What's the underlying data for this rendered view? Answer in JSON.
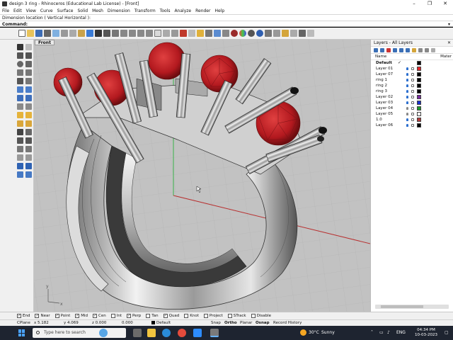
{
  "window": {
    "title": "design 3 ring - Rhinoceros (Educational Lab License) - [Front]",
    "minimize": "–",
    "maximize": "❐",
    "close": "✕"
  },
  "menu": [
    "File",
    "Edit",
    "View",
    "Curve",
    "Surface",
    "Solid",
    "Mesh",
    "Dimension",
    "Transform",
    "Tools",
    "Analyze",
    "Render",
    "Help"
  ],
  "command": {
    "history": "Dimension location ( Vertical  Horizontal ):",
    "label": "Command:",
    "value": ""
  },
  "viewport": {
    "name": "Front",
    "axis_y": "y",
    "axis_x": "x"
  },
  "layers_panel": {
    "title": "Layers - All Layers",
    "close": "✕",
    "col_name": "Name",
    "col_material": "Mater",
    "layers": [
      {
        "name": "Default",
        "current": true,
        "color": "#000000",
        "on": true
      },
      {
        "name": "Layer 01",
        "current": false,
        "color": "#e8262a",
        "on": true
      },
      {
        "name": "Layer 07",
        "current": false,
        "color": "#000000",
        "on": true
      },
      {
        "name": "ring 1",
        "current": false,
        "color": "#000000",
        "on": true
      },
      {
        "name": "ring 2",
        "current": false,
        "color": "#000000",
        "on": true
      },
      {
        "name": "ring 3",
        "current": false,
        "color": "#000000",
        "on": true
      },
      {
        "name": "Layer 02",
        "current": false,
        "color": "#7a2b9e",
        "on": true
      },
      {
        "name": "Layer 03",
        "current": false,
        "color": "#1a2fd0",
        "on": true
      },
      {
        "name": "Layer 04",
        "current": false,
        "color": "#1e9a2a",
        "on": false
      },
      {
        "name": "Layer 05",
        "current": false,
        "color": "#ffffff",
        "on": false
      },
      {
        "name": "1.0",
        "current": false,
        "color": "#b53a3a",
        "on": true
      },
      {
        "name": "Layer 06",
        "current": false,
        "color": "#000000",
        "on": true
      }
    ]
  },
  "osnaps": [
    {
      "label": "End",
      "checked": true
    },
    {
      "label": "Near",
      "checked": true
    },
    {
      "label": "Point",
      "checked": true
    },
    {
      "label": "Mid",
      "checked": true
    },
    {
      "label": "Cen",
      "checked": true
    },
    {
      "label": "Int",
      "checked": false
    },
    {
      "label": "Perp",
      "checked": true
    },
    {
      "label": "Tan",
      "checked": false
    },
    {
      "label": "Quad",
      "checked": true
    },
    {
      "label": "Knot",
      "checked": false
    },
    {
      "label": "Project",
      "checked": false
    },
    {
      "label": "STrack",
      "checked": false
    },
    {
      "label": "Disable",
      "checked": false
    }
  ],
  "status": {
    "cplane": "CPlane",
    "x": "x 5.182",
    "y": "y 4.069",
    "z": "z 0.000",
    "d": "0.000",
    "layer": "Default",
    "snap": "Snap",
    "ortho": "Ortho",
    "planar": "Planar",
    "osnap": "Osnap",
    "history": "Record History"
  },
  "taskbar": {
    "search_placeholder": "Type here to search",
    "temperature": "30°C",
    "weather": "Sunny",
    "tray_arrows": "˄",
    "language": "ENG",
    "time": "04:34 PM",
    "date": "10-03-2023"
  },
  "colors": {
    "gem": "#c0262b",
    "viewport_bg": "#c2c2c2",
    "taskbar": "#1e2430"
  }
}
